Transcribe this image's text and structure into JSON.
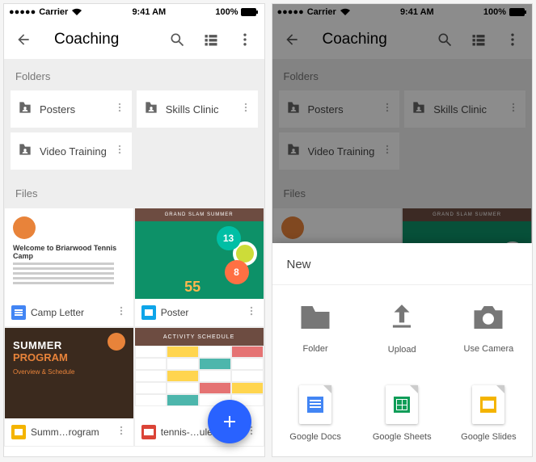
{
  "status": {
    "carrier": "Carrier",
    "time": "9:41 AM",
    "battery": "100%"
  },
  "appbar": {
    "title": "Coaching"
  },
  "sections": {
    "folders": "Folders",
    "files": "Files"
  },
  "folders": [
    {
      "name": "Posters"
    },
    {
      "name": "Skills Clinic"
    },
    {
      "name": "Video Training"
    }
  ],
  "files": [
    {
      "name": "Camp Letter",
      "type": "docs"
    },
    {
      "name": "Poster",
      "type": "ps"
    },
    {
      "name": "Summ…rogram",
      "type": "slides"
    },
    {
      "name": "tennis-…ule.p…",
      "type": "pdf"
    }
  ],
  "thumb": {
    "camp_title": "Welcome to Briarwood Tennis Camp",
    "poster_top": "GRAND SLAM SUMMER",
    "n13": "13",
    "n8": "8",
    "n55": "55",
    "sp1": "SUMMER",
    "sp2": "PROGRAM",
    "sp3": "Overview & Schedule",
    "sched_top": "ACTIVITY SCHEDULE"
  },
  "sheet": {
    "title": "New",
    "items": [
      {
        "label": "Folder",
        "kind": "folder"
      },
      {
        "label": "Upload",
        "kind": "upload"
      },
      {
        "label": "Use Camera",
        "kind": "camera"
      },
      {
        "label": "Google Docs",
        "kind": "docs"
      },
      {
        "label": "Google Sheets",
        "kind": "sheets"
      },
      {
        "label": "Google Slides",
        "kind": "slides"
      }
    ]
  }
}
